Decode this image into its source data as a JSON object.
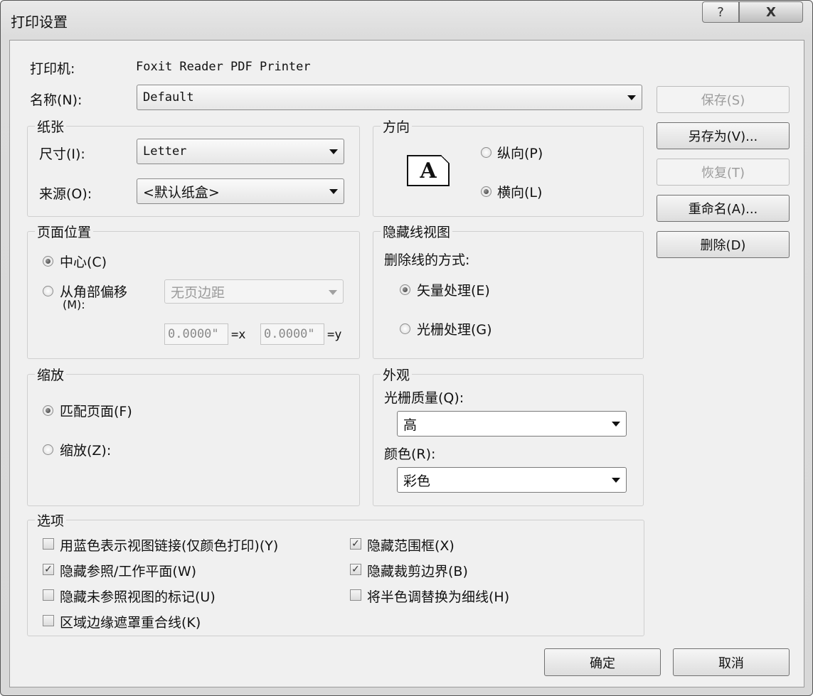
{
  "window": {
    "title": "打印设置",
    "help_icon": "?",
    "close_icon": "X"
  },
  "printer": {
    "label": "打印机:",
    "value": "Foxit Reader PDF Printer"
  },
  "name": {
    "label": "名称(N):",
    "value": "Default"
  },
  "paper": {
    "title": "纸张",
    "size_label": "尺寸(I):",
    "size_value": "Letter",
    "source_label": "来源(O):",
    "source_value": "<默认纸盒>"
  },
  "orientation": {
    "title": "方向",
    "icon_letter": "A",
    "portrait_label": "纵向(P)",
    "landscape_label": "横向(L)",
    "selected": "landscape"
  },
  "page_position": {
    "title": "页面位置",
    "center_label": "中心(C)",
    "offset_label": "从角部偏移",
    "offset_label_key": "(M):",
    "margin_value": "无页边距",
    "x_value": "0.0000\"",
    "x_suffix": "=x",
    "y_value": "0.0000\"",
    "y_suffix": "=y",
    "selected": "center"
  },
  "hidden_line": {
    "title": "隐藏线视图",
    "mode_label": "删除线的方式:",
    "vector_label": "矢量处理(E)",
    "raster_label": "光栅处理(G)",
    "selected": "vector"
  },
  "zoom": {
    "title": "缩放",
    "fit_label": "匹配页面(F)",
    "zoom_label": "缩放(Z):",
    "selected": "fit"
  },
  "appearance": {
    "title": "外观",
    "raster_quality_label": "光栅质量(Q):",
    "raster_quality_value": "高",
    "color_label": "颜色(R):",
    "color_value": "彩色"
  },
  "options": {
    "title": "选项",
    "items": [
      {
        "label": "用蓝色表示视图链接(仅颜色打印)(Y)",
        "checked": false
      },
      {
        "label": "隐藏参照/工作平面(W)",
        "checked": true
      },
      {
        "label": "隐藏未参照视图的标记(U)",
        "checked": false
      },
      {
        "label": "区域边缘遮罩重合线(K)",
        "checked": false
      },
      {
        "label": "隐藏范围框(X)",
        "checked": true
      },
      {
        "label": "隐藏裁剪边界(B)",
        "checked": true
      },
      {
        "label": "将半色调替换为细线(H)",
        "checked": false
      }
    ],
    "check_mark": "✓"
  },
  "side_buttons": {
    "save": "保存(S)",
    "save_as": "另存为(V)...",
    "revert": "恢复(T)",
    "rename": "重命名(A)...",
    "delete": "删除(D)"
  },
  "footer": {
    "ok": "确定",
    "cancel": "取消"
  }
}
